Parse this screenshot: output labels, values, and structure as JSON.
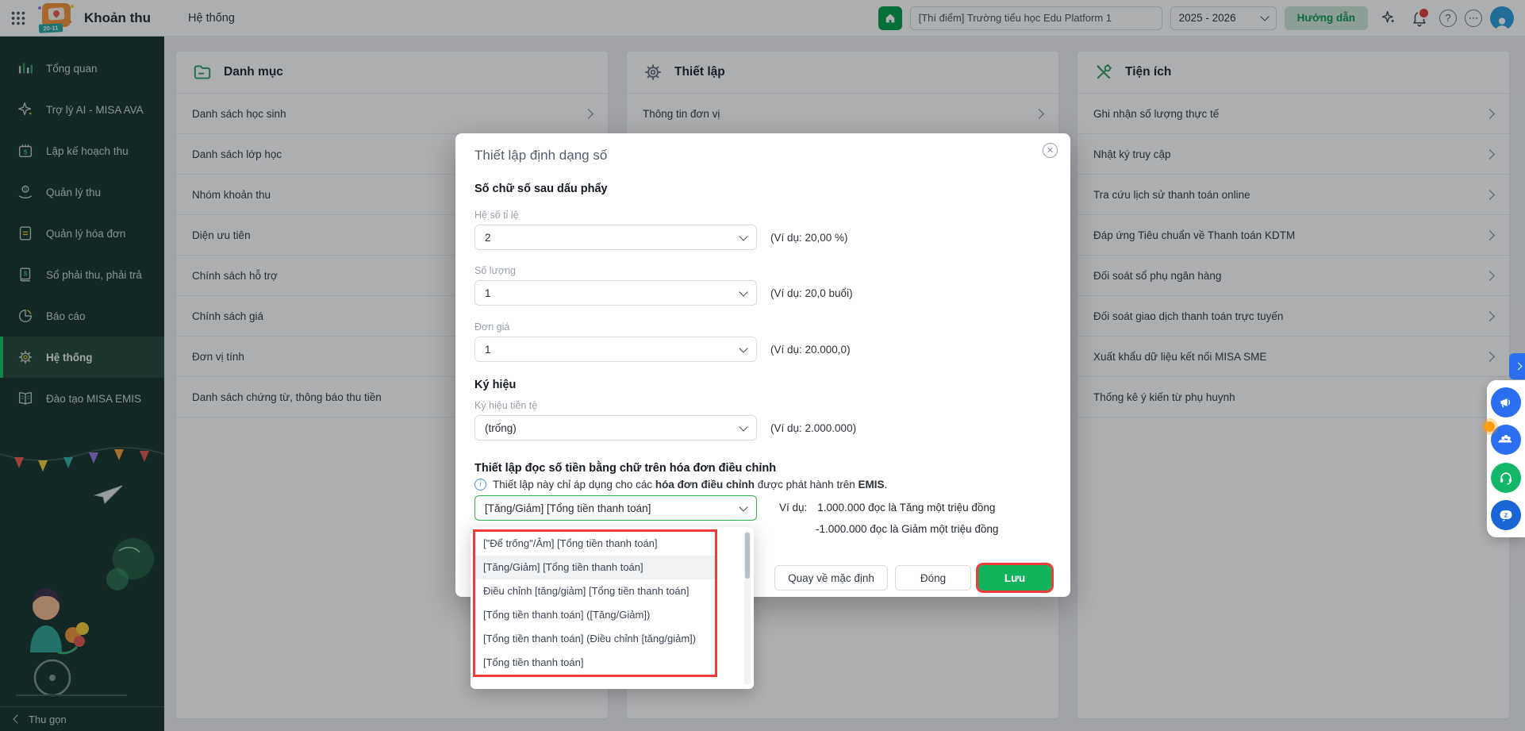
{
  "topbar": {
    "app_title": "Khoản thu",
    "menu_item": "Hệ thống",
    "logo_badge": "20-11",
    "school": "[Thí điểm] Trường tiểu học Edu Platform 1",
    "school_year": "2025 - 2026",
    "guide_button": "Hướng dẫn"
  },
  "sidebar": {
    "items": [
      "Tổng quan",
      "Trợ lý AI - MISA AVA",
      "Lập kế hoạch thu",
      "Quản lý thu",
      "Quản lý hóa đơn",
      "Sổ phải thu, phải trả",
      "Báo cáo",
      "Hệ thống",
      "Đào tạo MISA EMIS"
    ],
    "active_item": "Hệ thống",
    "collapse_label": "Thu gọn"
  },
  "panels": {
    "danh_muc": {
      "title": "Danh mục",
      "items": [
        "Danh sách học sinh",
        "Danh sách lớp học",
        "Nhóm khoản thu",
        "Diện ưu tiên",
        "Chính sách hỗ trợ",
        "Chính sách giá",
        "Đơn vị tính",
        "Danh sách chứng từ, thông báo thu tiền"
      ]
    },
    "thiet_lap": {
      "title": "Thiết lập",
      "items": [
        "Thông tin đơn vị"
      ]
    },
    "tien_ich": {
      "title": "Tiện ích",
      "items": [
        "Ghi nhận số lượng thực tế",
        "Nhật ký truy cập",
        "Tra cứu lịch sử thanh toán online",
        "Đáp ứng Tiêu chuẩn về Thanh toán KDTM",
        "Đối soát sổ phụ ngân hàng",
        "Đối soát giao dịch thanh toán trực tuyến",
        "Xuất khẩu dữ liệu kết nối MISA SME",
        "Thống kê ý kiến từ phụ huynh"
      ]
    }
  },
  "modal": {
    "title": "Thiết lập định dạng số",
    "decimal_section": "Số chữ số sau dấu phẩy",
    "fields": [
      {
        "label": "Hệ số tỉ lệ",
        "value": "2",
        "hint": "(Ví dụ: 20,00 %)"
      },
      {
        "label": "Số lượng",
        "value": "1",
        "hint": "(Ví dụ: 20,0 buổi)"
      },
      {
        "label": "Đơn giá",
        "value": "1",
        "hint": "(Ví dụ: 20.000,0)"
      }
    ],
    "symbol_section": "Ký hiệu",
    "currency_field": {
      "label": "Ký hiệu tiền tệ",
      "value": "(trống)",
      "hint": "(Ví dụ: 2.000.000)"
    },
    "reading_section": "Thiết lập đọc số tiền bằng chữ trên hóa đơn điều chỉnh",
    "note": {
      "prefix": "Thiết lập này chỉ áp dụng cho các ",
      "bold1": "hóa đơn điều chỉnh",
      "middle": " được phát hành trên ",
      "bold2": "EMIS",
      "suffix": "."
    },
    "reading_value": "[Tăng/Giảm] [Tổng tiền thanh toán]",
    "example": {
      "label": "Ví dụ:",
      "line1": "1.000.000 đọc là Tăng một triệu đồng",
      "line2": "-1.000.000 đọc là Giảm một triệu đồng"
    },
    "dropdown_options": [
      "[\"Để trống\"/Âm] [Tổng tiền thanh toán]",
      "[Tăng/Giảm] [Tổng tiền thanh toán]",
      "Điều chỉnh [tăng/giảm] [Tổng tiền thanh toán]",
      "[Tổng tiền thanh toán] ([Tăng/Giảm])",
      "[Tổng tiền thanh toán] (Điều chỉnh [tăng/giảm])",
      "[Tổng tiền thanh toán]"
    ],
    "highlighted_option_index": 1,
    "buttons": {
      "reset": "Quay về mặc định",
      "close": "Đóng",
      "save": "Lưu"
    }
  },
  "icons": {
    "apps-grid-icon": "9-dot grid",
    "home-icon": "white house on green",
    "sparkle-icon": "4-point star",
    "bell-icon": "notification bell with red badge",
    "help-icon": "? in circle",
    "more-icon": "… in circle",
    "avatar": "person in blue circle",
    "folder-icon": "green folder",
    "gear-icon": "settings gear",
    "tools-icon": "crossed wrench and screwdriver",
    "info-icon": "blue i in circle",
    "close-icon": "x in circle",
    "chevron-right-icon": "›",
    "chevron-down-icon": "⌄",
    "megaphone-icon": "announcement megaphone",
    "community-icon": "people group with orange badge",
    "headset-icon": "support headset",
    "chat-icon": "chat bubble"
  },
  "colors": {
    "accent_green": "#00a04c",
    "annotation_red": "#ee3b3b",
    "select_focus_green": "#2fae53",
    "save_button_green": "#10b35c",
    "sidebar_bg": "#16352c",
    "sidebar_active": "#26463c",
    "widget_blue": "#2b6ff0",
    "support_green": "#12b76a",
    "notification_red": "#e23c39",
    "badge_orange": "#ff9f0e",
    "guide_button_bg": "#cfe7d9"
  }
}
